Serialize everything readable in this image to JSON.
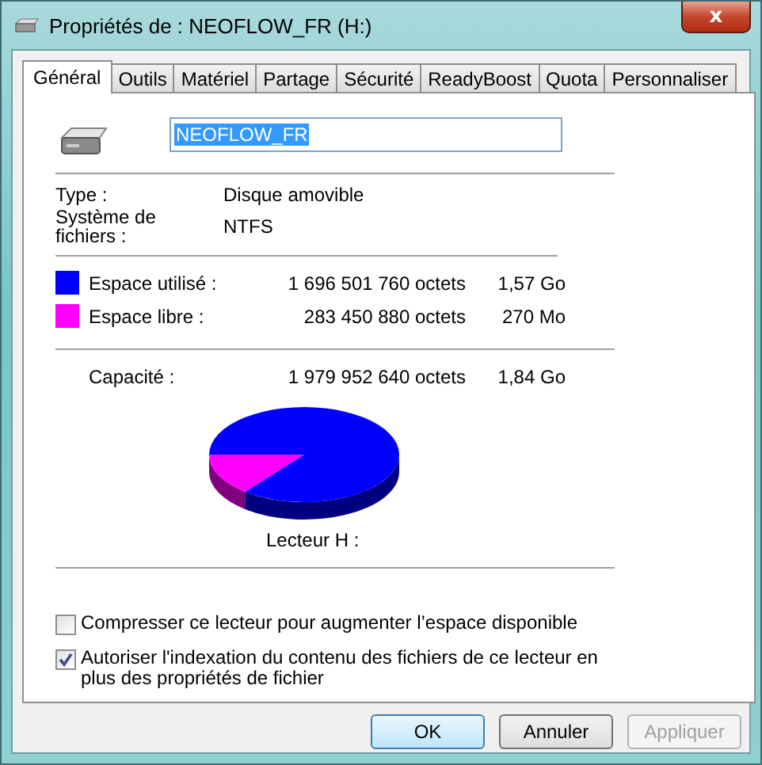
{
  "window": {
    "title": "Propriétés de : NEOFLOW_FR (H:)",
    "close": "x"
  },
  "tabs": [
    {
      "label": "Général",
      "selected": true
    },
    {
      "label": "Outils",
      "selected": false
    },
    {
      "label": "Matériel",
      "selected": false
    },
    {
      "label": "Partage",
      "selected": false
    },
    {
      "label": "Sécurité",
      "selected": false
    },
    {
      "label": "ReadyBoost",
      "selected": false
    },
    {
      "label": "Quota",
      "selected": false
    },
    {
      "label": "Personnaliser",
      "selected": false
    }
  ],
  "name_field": {
    "value": "NEOFLOW_FR"
  },
  "info": [
    {
      "label": "Type :",
      "value": "Disque amovible"
    },
    {
      "label": "Système de fichiers :",
      "value": "NTFS"
    }
  ],
  "space": [
    {
      "label": "Espace utilisé :",
      "bytes": "1 696 501 760 octets",
      "size": "1,57 Go",
      "color": "#0000ff"
    },
    {
      "label": "Espace libre :",
      "bytes": "283 450 880 octets",
      "size": "270 Mo",
      "color": "#ff00ff"
    }
  ],
  "capacity": {
    "label": "Capacité :",
    "bytes": "1 979 952 640 octets",
    "size": "1,84 Go"
  },
  "drive_label": "Lecteur H :",
  "options": [
    {
      "label": "Compresser ce lecteur pour augmenter l’espace disponible",
      "checked": false
    },
    {
      "label": "Autoriser l'indexation du contenu des fichiers de ce lecteur en plus des propriétés de fichier",
      "checked": true
    }
  ],
  "buttons": [
    {
      "label": "OK",
      "kind": "default",
      "disabled": false
    },
    {
      "label": "Annuler",
      "kind": "normal",
      "disabled": false
    },
    {
      "label": "Appliquer",
      "kind": "normal",
      "disabled": true
    }
  ]
}
